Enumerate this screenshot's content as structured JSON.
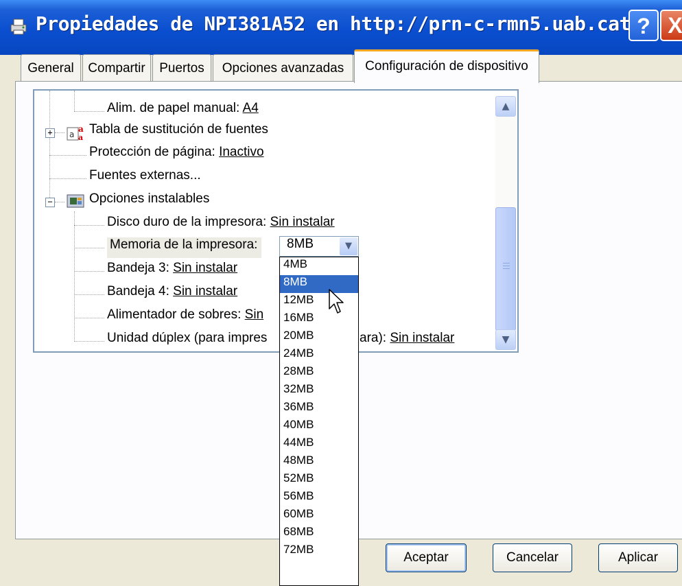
{
  "window": {
    "title": "Propiedades de NPI381A52 en http://prn-c-rmn5.uab.cat",
    "help_label": "?",
    "close_label": "X"
  },
  "tabs": [
    {
      "label": "General",
      "active": false
    },
    {
      "label": "Compartir",
      "active": false
    },
    {
      "label": "Puertos",
      "active": false
    },
    {
      "label": "Opciones avanzadas",
      "active": false
    },
    {
      "label": "Configuración de dispositivo",
      "active": true
    }
  ],
  "tree": {
    "manual_feed": {
      "label": "Alim. de papel manual: ",
      "value": "A4"
    },
    "font_substitution": {
      "label": "Tabla de sustitución de fuentes",
      "icon": "font-table-icon"
    },
    "page_protect": {
      "label": "Protección de página: ",
      "value": "Inactivo"
    },
    "external_fonts": {
      "label": "Fuentes externas..."
    },
    "installable_options": {
      "label": "Opciones instalables",
      "icon": "printer-options-icon"
    },
    "hard_disk": {
      "label": "Disco duro de la impresora: ",
      "value": "Sin instalar"
    },
    "printer_memory": {
      "label": "Memoria de la impresora:",
      "value": "8MB"
    },
    "tray3": {
      "label": "Bandeja 3: ",
      "value": "Sin instalar"
    },
    "tray4": {
      "label": "Bandeja 4: ",
      "value": "Sin instalar"
    },
    "envelope_feeder": {
      "label": "Alimentador de sobres: ",
      "value": "Sin"
    },
    "duplex": {
      "label_left": "Unidad dúplex (para impres",
      "label_right": "ara): ",
      "value": "Sin instalar"
    }
  },
  "memory_dropdown": {
    "selected": "8MB",
    "options": [
      "4MB",
      "8MB",
      "12MB",
      "16MB",
      "20MB",
      "24MB",
      "28MB",
      "32MB",
      "36MB",
      "40MB",
      "44MB",
      "48MB",
      "52MB",
      "56MB",
      "60MB",
      "68MB",
      "72MB"
    ]
  },
  "buttons": {
    "ok": "Aceptar",
    "cancel": "Cancelar",
    "apply": "Aplicar"
  },
  "colors": {
    "selection": "#316ac5",
    "titlebar": "#0a4fd0",
    "active_tab_accent": "#f5a823"
  }
}
